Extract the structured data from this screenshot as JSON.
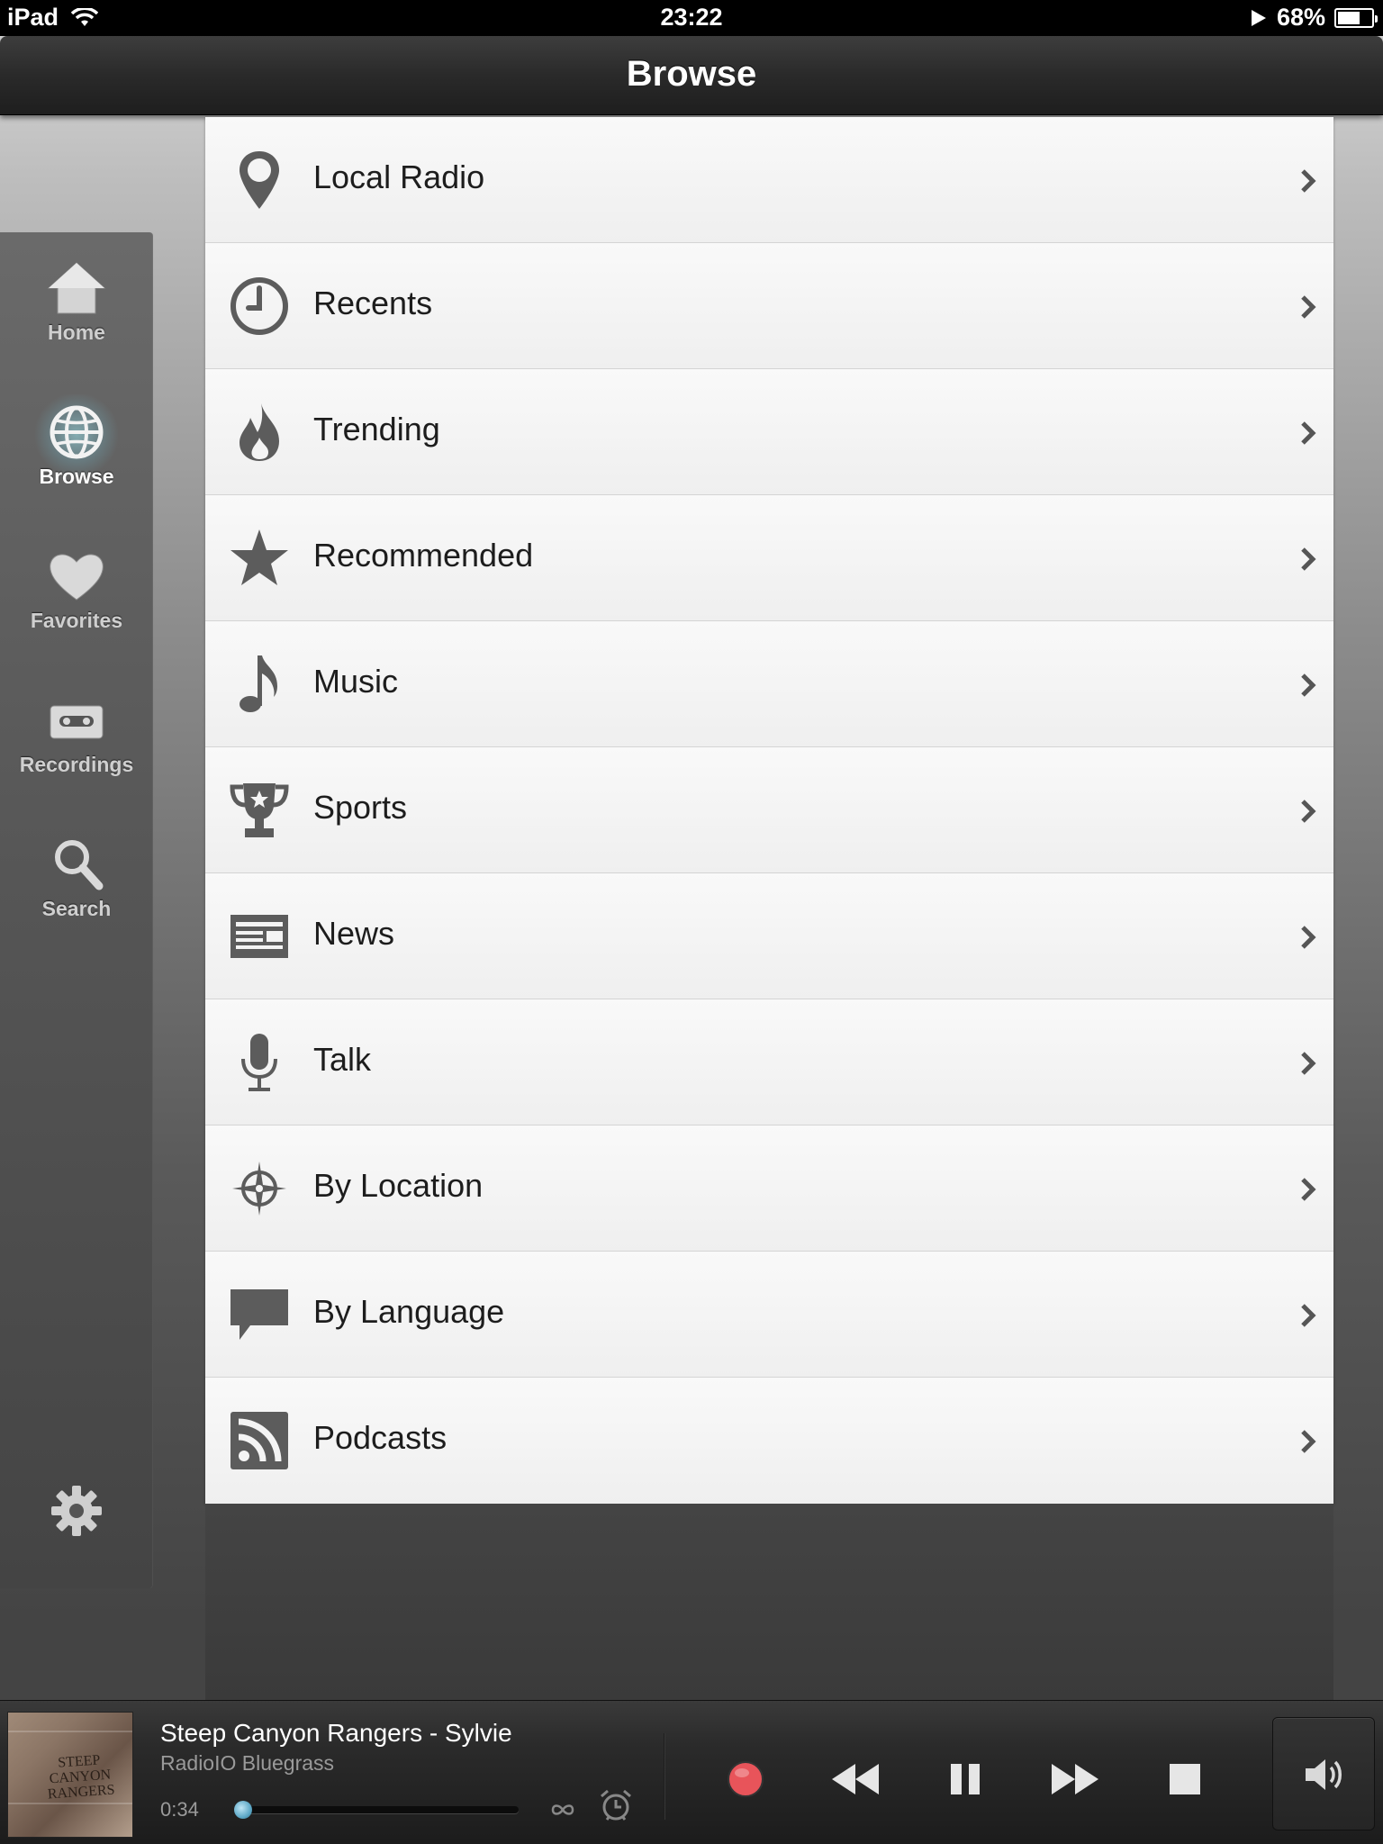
{
  "status_bar": {
    "device": "iPad",
    "time": "23:22",
    "battery": "68%",
    "battery_level": 0.68
  },
  "nav": {
    "title": "Browse"
  },
  "sidebar": {
    "tabs": [
      {
        "label": "Home",
        "icon": "home-icon",
        "active": false
      },
      {
        "label": "Browse",
        "icon": "globe-icon",
        "active": true
      },
      {
        "label": "Favorites",
        "icon": "heart-icon",
        "active": false
      },
      {
        "label": "Recordings",
        "icon": "cassette-icon",
        "active": false
      },
      {
        "label": "Search",
        "icon": "search-icon",
        "active": false
      }
    ],
    "settings_icon": "gear-icon"
  },
  "browse_list": [
    {
      "label": "Local Radio",
      "icon": "location-pin-icon"
    },
    {
      "label": "Recents",
      "icon": "clock-icon"
    },
    {
      "label": "Trending",
      "icon": "flame-icon"
    },
    {
      "label": "Recommended",
      "icon": "star-icon"
    },
    {
      "label": "Music",
      "icon": "music-note-icon"
    },
    {
      "label": "Sports",
      "icon": "trophy-icon"
    },
    {
      "label": "News",
      "icon": "newspaper-icon"
    },
    {
      "label": "Talk",
      "icon": "microphone-icon"
    },
    {
      "label": "By Location",
      "icon": "compass-icon"
    },
    {
      "label": "By Language",
      "icon": "speech-bubble-icon"
    },
    {
      "label": "Podcasts",
      "icon": "rss-icon"
    }
  ],
  "player": {
    "track": "Steep Canyon Rangers - Sylvie",
    "station": "RadioIO Bluegrass",
    "elapsed": "0:34",
    "progress": 0.0,
    "album_art_text": "STEEP CANYON RANGERS",
    "controls": [
      "record-icon",
      "rewind-icon",
      "pause-icon",
      "fast-forward-icon",
      "stop-icon"
    ],
    "record_color": "#e8545a",
    "accent_color": "#5fa9c7"
  }
}
